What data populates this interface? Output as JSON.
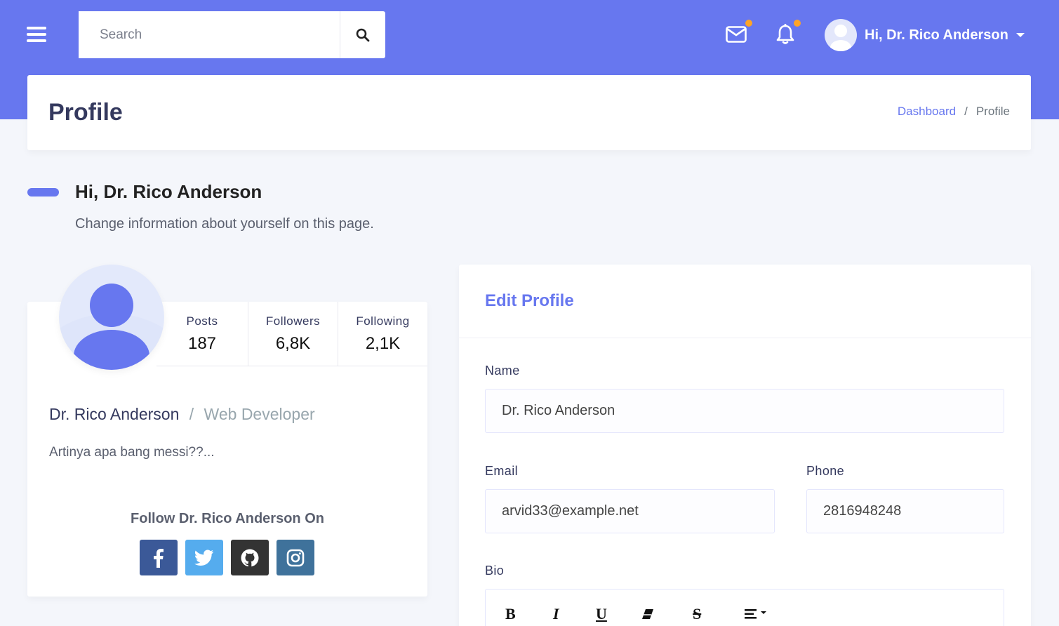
{
  "colors": {
    "primary": "#6777ef",
    "notification_dot": "#ffa426",
    "facebook": "#3b5998",
    "twitter": "#55acee",
    "github": "#333333",
    "instagram": "#3f729b"
  },
  "navbar": {
    "menu_icon": "hamburger-icon",
    "search_placeholder": "Search",
    "search_icon": "search-icon",
    "mail_icon": "envelope-icon",
    "notification_icon": "bell-icon",
    "user_greeting": "Hi, Dr. Rico Anderson"
  },
  "header": {
    "title": "Profile",
    "breadcrumb": [
      "Dashboard",
      "/",
      "Profile"
    ]
  },
  "greeting": {
    "title": "Hi, Dr. Rico Anderson",
    "subtitle": "Change information about yourself on this page."
  },
  "profile": {
    "stats": [
      {
        "label": "Posts",
        "value": "187"
      },
      {
        "label": "Followers",
        "value": "6,8K"
      },
      {
        "label": "Following",
        "value": "2,1K"
      }
    ],
    "name": "Dr. Rico Anderson",
    "separator": "/",
    "job": "Web Developer",
    "bio": "Artinya apa bang messi??...",
    "follow_title": "Follow Dr. Rico Anderson On",
    "socials": [
      "facebook",
      "twitter",
      "github",
      "instagram"
    ]
  },
  "edit_profile": {
    "title": "Edit Profile",
    "name_label": "Name",
    "name_value": "Dr. Rico Anderson",
    "email_label": "Email",
    "email_value": "arvid33@example.net",
    "phone_label": "Phone",
    "phone_value": "2816948248",
    "bio_label": "Bio",
    "toolbar": [
      "bold",
      "italic",
      "underline",
      "eraser",
      "strikethrough",
      "align"
    ]
  }
}
